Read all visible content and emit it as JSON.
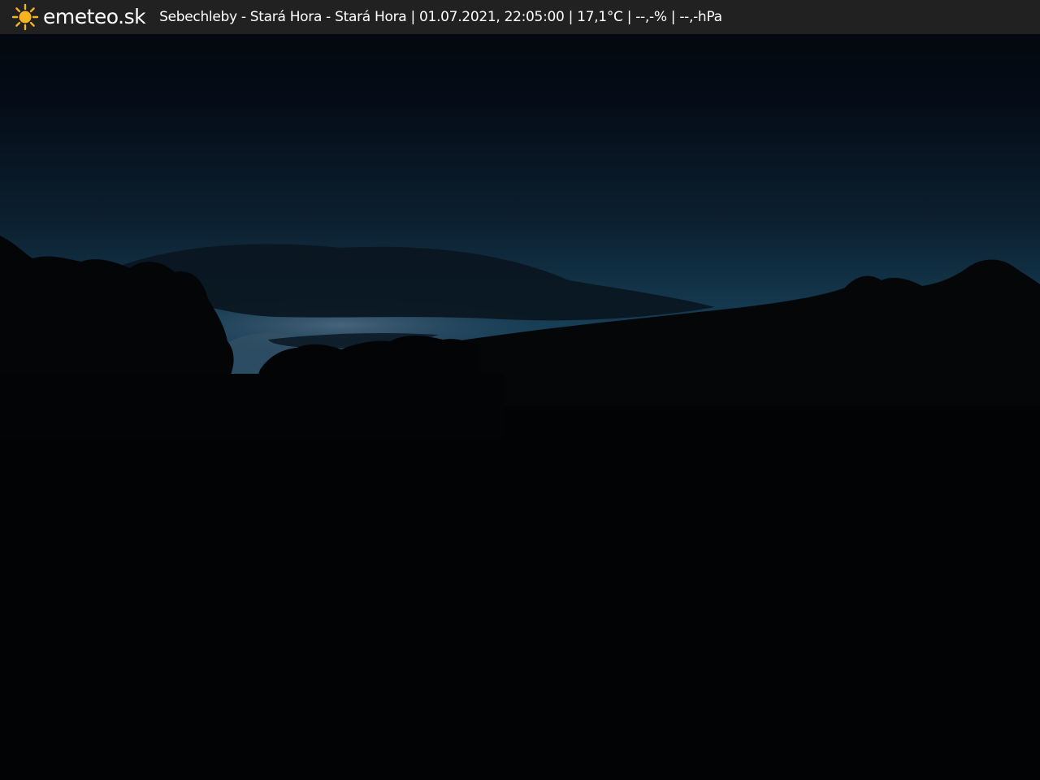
{
  "brand": {
    "logo_icon": "sun-icon",
    "logo_color": "#F5B324",
    "name": "emeteo.sk"
  },
  "caption": {
    "text": "Sebechleby - Stará Hora - Stará Hora | 01.07.2021, 22:05:00 | 17,1°C | --,-% | --,-hPa"
  },
  "colors": {
    "bar_background": "#222222",
    "sky_top": "#05070D",
    "sky_horizon": "#1D4A63",
    "foreground": "#020305"
  }
}
